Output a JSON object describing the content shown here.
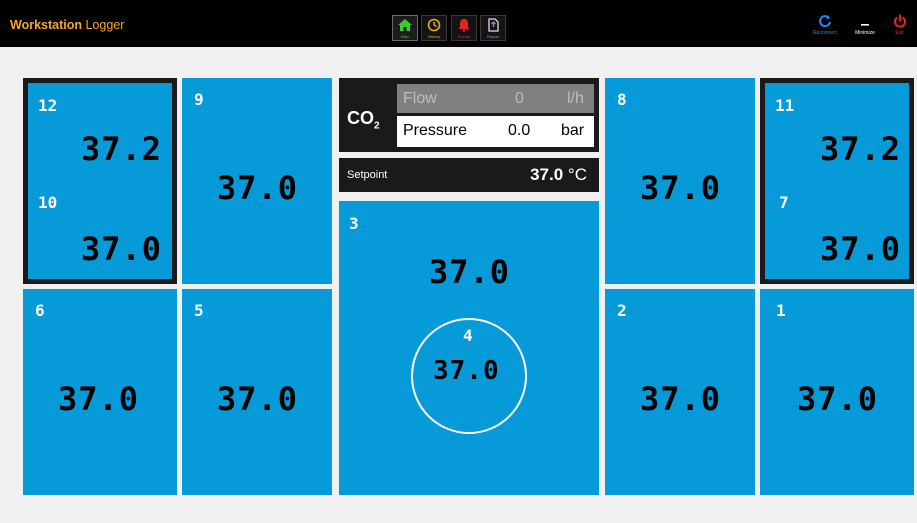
{
  "app": {
    "title_bold": "Workstation",
    "title_rest": "Logger"
  },
  "nav": [
    {
      "label": "Main",
      "icon": "home-icon",
      "color": "#3ccc2a"
    },
    {
      "label": "History",
      "icon": "history-icon",
      "color": "#f0a81e"
    },
    {
      "label": "Events",
      "icon": "bell-icon",
      "color": "#e8251b"
    },
    {
      "label": "Report",
      "icon": "report-icon",
      "color": "#b07ad8"
    }
  ],
  "window": {
    "reconnect": "Reconnect",
    "minimize": "Minimize",
    "exit": "Exit"
  },
  "co2": {
    "label": "CO",
    "sub": "2",
    "flow": {
      "label": "Flow",
      "value": "0",
      "unit": "l/h"
    },
    "pressure": {
      "label": "Pressure",
      "value": "0.0",
      "unit": "bar"
    }
  },
  "setpoint": {
    "label": "Setpoint",
    "value": "37.0",
    "unit": "°C"
  },
  "chambers": {
    "c12": {
      "id": "12",
      "value": "37.2"
    },
    "c10": {
      "id": "10",
      "value": "37.0"
    },
    "c9": {
      "id": "9",
      "value": "37.0"
    },
    "c6": {
      "id": "6",
      "value": "37.0"
    },
    "c5": {
      "id": "5",
      "value": "37.0"
    },
    "c3": {
      "id": "3",
      "value": "37.0"
    },
    "c4": {
      "id": "4",
      "value": "37.0"
    },
    "c8": {
      "id": "8",
      "value": "37.0"
    },
    "c11": {
      "id": "11",
      "value": "37.2"
    },
    "c7": {
      "id": "7",
      "value": "37.0"
    },
    "c2": {
      "id": "2",
      "value": "37.0"
    },
    "c1": {
      "id": "1",
      "value": "37.0"
    }
  },
  "colors": {
    "panel": "#079ad9",
    "accent": "#f7a824",
    "frame": "#1a1a1a"
  }
}
